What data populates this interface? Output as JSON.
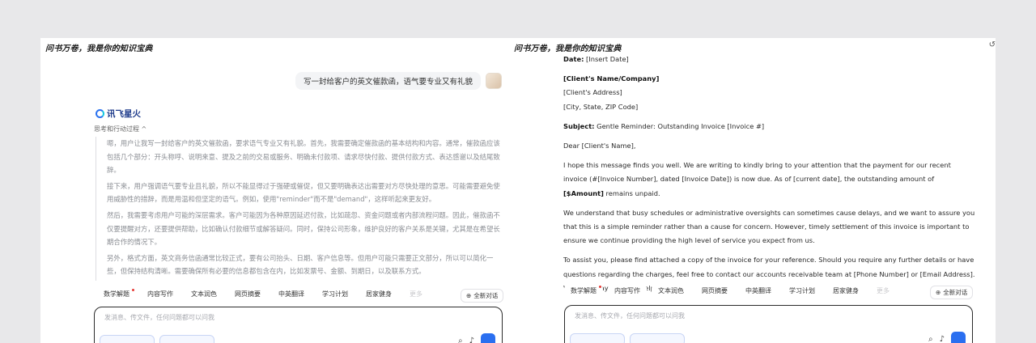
{
  "left_panel": {
    "brand_title": "问书万卷，我是你的知识宝典",
    "user_message": "写一封给客户的英文催款函，语气要专业又有礼貌",
    "assistant_name": "讯飞星火",
    "thinking_toggle": "思考和行动过程 ^",
    "thinking": [
      "嗯，用户让我写一封给客户的英文催款函，要求语气专业又有礼貌。首先，我需要确定催款函的基本结构和内容。通常，催款函应该包括几个部分：开头称呼、说明来意、提及之前的交易或服务、明确未付款项、请求尽快付款、提供付款方式、表达感谢以及结尾致辞。",
      "接下来，用户强调语气要专业且礼貌，所以不能显得过于强硬或催促，但又要明确表达出需要对方尽快处理的意思。可能需要避免使用威胁性的措辞，而是用温和但坚定的语气。例如，使用\"reminder\"而不是\"demand\"，这样听起来更友好。",
      "然后，我需要考虑用户可能的深层需求。客户可能因为各种原因延迟付款，比如疏忽、资金问题或者内部流程问题。因此，催款函不仅要提醒对方，还要提供帮助，比如确认付款细节或解答疑问。同时，保持公司形象，维护良好的客户关系是关键，尤其是在希望长期合作的情况下。",
      "另外，格式方面，英文商务信函通常比较正式，要有公司抬头、日期、客户信息等。但用户可能只需要正文部分，所以可以简化一些，但保持结构清晰。需要确保所有必要的信息都包含在内，比如发票号、金额、到期日，以及联系方式。"
    ]
  },
  "right_panel": {
    "brand_title": "问书万卷，我是你的知识宝典",
    "letter": {
      "date_label": "Date:",
      "date_value": "[Insert Date]",
      "client_name": "[Client's Name/Company]",
      "client_address": "[Client's Address]",
      "client_city": "[City, State, ZIP Code]",
      "subject_label": "Subject:",
      "subject_value": "Gentle Reminder: Outstanding Invoice [Invoice #]",
      "salutation": "Dear [Client's Name],",
      "p1_text": "I hope this message finds you well. We are writing to kindly bring to your attention that the payment for our recent invoice (#[Invoice Number], dated [Invoice Date]) is now due. As of [current date], the outstanding amount of",
      "p1_amount": "[$Amount]",
      "p1_tail": "remains unpaid.",
      "p2": "We understand that busy schedules or administrative oversights can sometimes cause delays, and we want to assure you that this is a simple reminder rather than a cause for concern. However, timely settlement of this invoice is important to ensure we continue providing the high level of service you expect from us.",
      "p3": "To assist you, please find attached a copy of the invoice for your reference. Should you require any further details or have questions regarding the charges, feel free to contact our accounts receivable team at [Phone Number] or [Email Address]. We are always here to help."
    }
  },
  "chips": [
    "数学解题",
    "内容写作",
    "文本润色",
    "网页摘要",
    "中英翻译",
    "学习计划",
    "居家健身",
    "更多"
  ],
  "new_chat_label": "全新对话",
  "input_placeholder": "发消息、传文件，任何问题都可以问我",
  "colors": {
    "accent": "#2a6ff0",
    "thinking_text": "#8a8d93"
  },
  "icons": [
    "history-icon",
    "refresh-icon",
    "new-chat-icon",
    "send-icon",
    "mic-icon",
    "attach-icon"
  ]
}
